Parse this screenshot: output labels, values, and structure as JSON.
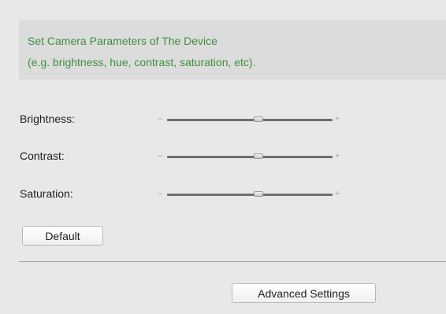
{
  "info": {
    "line1": "Set Camera Parameters of The Device",
    "line2": "(e.g. brightness, hue, contrast, saturation, etc)."
  },
  "params": [
    {
      "label": "Brightness:",
      "value_fraction": 0.55,
      "minus_symbol": "–",
      "plus_symbol": "+"
    },
    {
      "label": "Contrast:",
      "value_fraction": 0.55,
      "minus_symbol": "–",
      "plus_symbol": "+"
    },
    {
      "label": "Saturation:",
      "value_fraction": 0.55,
      "minus_symbol": "–",
      "plus_symbol": "+"
    }
  ],
  "buttons": {
    "default_label": "Default",
    "advanced_label": "Advanced Settings"
  },
  "colors": {
    "info_text": "#3f8f3f",
    "background": "#e8e8e8",
    "info_background": "#dcdcdc"
  }
}
